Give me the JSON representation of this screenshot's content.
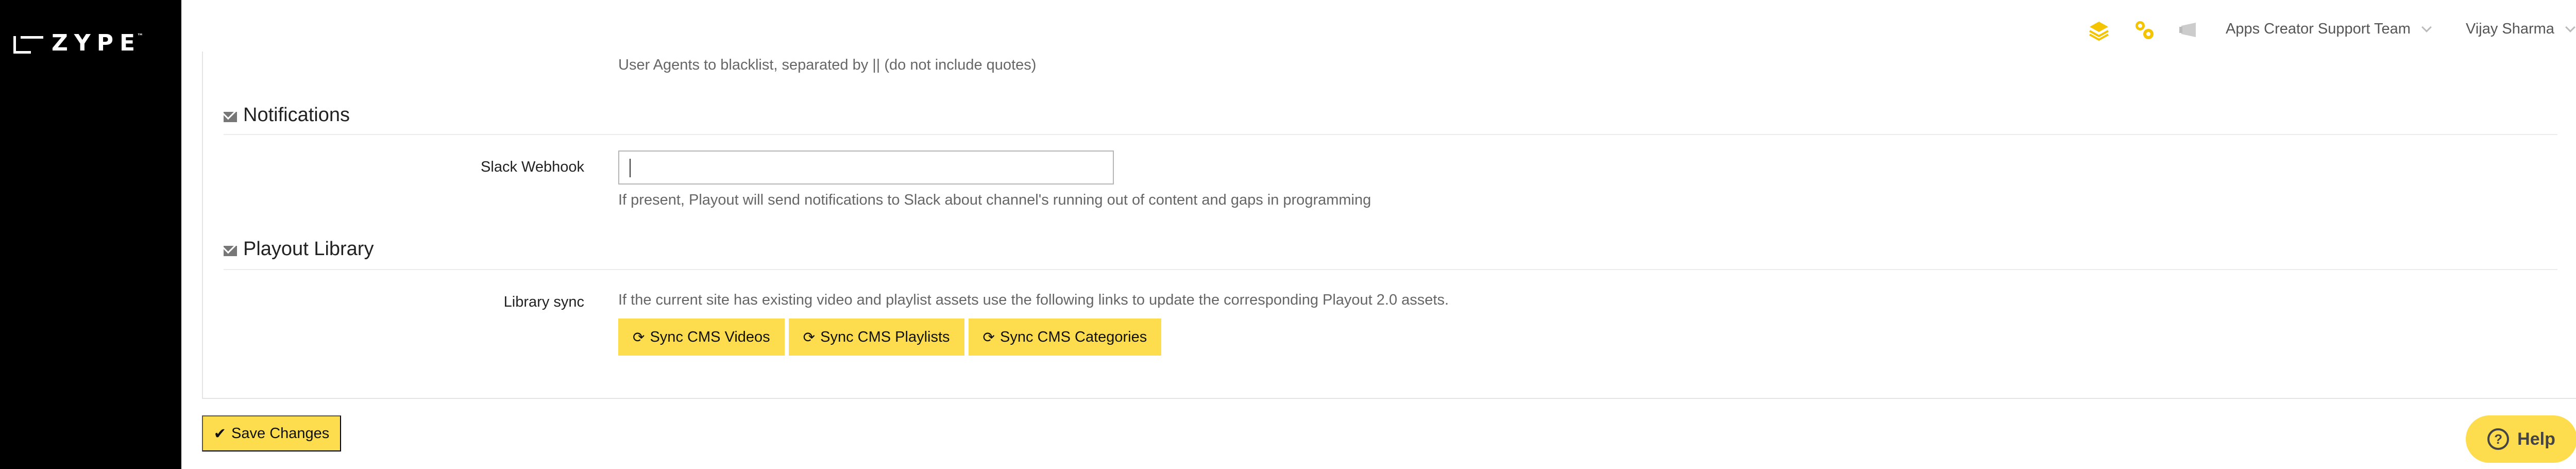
{
  "brand": {
    "logo_text": "ZYPE",
    "trademark": "™"
  },
  "topbar": {
    "icons": [
      "layers-icon",
      "integrations-icon",
      "notifications-icon"
    ],
    "team_label": "Apps Creator Support Team",
    "user_label": "Vijay Sharma"
  },
  "form": {
    "user_agents_help": "User Agents to blacklist, separated by || (do not include quotes)",
    "notifications": {
      "title": "Notifications",
      "slack_label": "Slack Webhook",
      "slack_value": "",
      "slack_help": "If present, Playout will send notifications to Slack about channel's running out of content and gaps in programming"
    },
    "playout_library": {
      "title": "Playout Library",
      "sync_label": "Library sync",
      "sync_help": "If the current site has existing video and playlist assets use the following links to update the corresponding Playout 2.0 assets.",
      "buttons": [
        {
          "label": "Sync CMS Videos"
        },
        {
          "label": "Sync CMS Playlists"
        },
        {
          "label": "Sync CMS Categories"
        }
      ]
    }
  },
  "actions": {
    "save_label": "Save Changes",
    "help_label": "Help"
  },
  "colors": {
    "sidebar": "#000000",
    "accent": "#fddd4e"
  }
}
